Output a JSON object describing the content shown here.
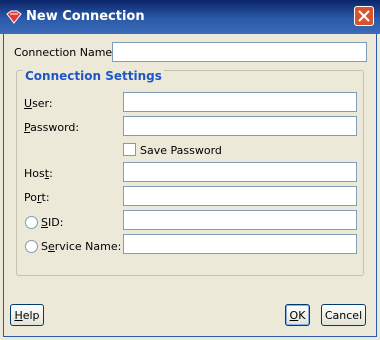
{
  "window": {
    "title": "New Connection"
  },
  "form": {
    "connection_name": {
      "label": "Connection Name:",
      "value": ""
    },
    "settings_group": {
      "title": "Connection Settings",
      "user": {
        "label_pre": "",
        "label_u": "U",
        "label_post": "ser:",
        "value": ""
      },
      "password": {
        "label_pre": "",
        "label_u": "P",
        "label_post": "assword:",
        "value": ""
      },
      "save_password": {
        "label": "Save Password",
        "checked": false
      },
      "host": {
        "label_pre": "Hos",
        "label_u": "t",
        "label_post": ":",
        "value": ""
      },
      "port": {
        "label_pre": "Po",
        "label_u": "r",
        "label_post": "t:",
        "value": ""
      },
      "sid": {
        "label_pre": "",
        "label_u": "S",
        "label_post": "ID:",
        "selected": false,
        "value": ""
      },
      "service_name": {
        "label_pre": "S",
        "label_u": "e",
        "label_post": "rvice Name:",
        "selected": false,
        "value": ""
      }
    }
  },
  "buttons": {
    "help": {
      "label_pre": "",
      "label_u": "H",
      "label_post": "elp"
    },
    "ok": {
      "label_pre": "",
      "label_u": "O",
      "label_post": "K"
    },
    "cancel": {
      "label": "Cancel"
    }
  },
  "colors": {
    "titlebar": "#0a246a",
    "group_title": "#1f56c8",
    "close_button": "#d8532b"
  }
}
